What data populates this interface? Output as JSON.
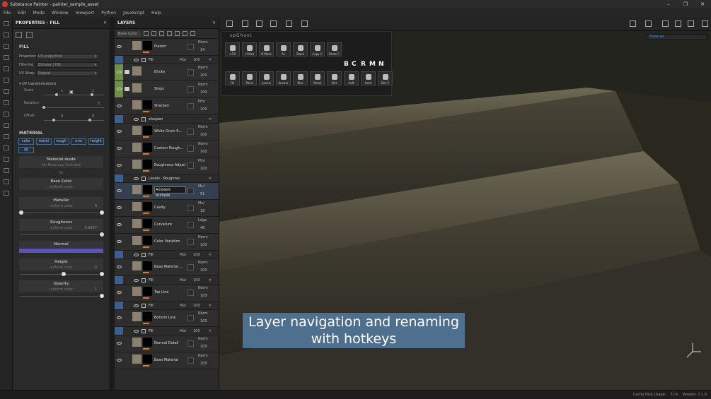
{
  "window": {
    "title": "Substance Painter - painter_sample_asset",
    "controls": [
      "–",
      "❐",
      "✕"
    ]
  },
  "menu": [
    "File",
    "Edit",
    "Mode",
    "Window",
    "Viewport",
    "Python",
    "JavaScript",
    "Help"
  ],
  "properties": {
    "panel_title": "PROPERTIES - FILL",
    "fill_header": "FILL",
    "projection_label": "Projection",
    "projection_value": "UV projection",
    "filtering_label": "Filtering",
    "filtering_value": "Bilinear | HQ",
    "uvwrap_label": "UV Wrap",
    "uvwrap_value": "Repeat",
    "uv_transformations": "UV transformations",
    "scale_label": "Scale",
    "scale_value": "1",
    "scale_value2": "1",
    "rotation_label": "Rotation",
    "rotation_value": "0",
    "offset_label": "Offset",
    "offset_value": "0",
    "offset_value2": "0",
    "material_header": "MATERIAL",
    "channels": [
      "color",
      "metal",
      "rough",
      "nrm",
      "height",
      "op"
    ],
    "material_mode": "Material mode",
    "no_resource": "No Resource Selected",
    "or": "Or",
    "base_color": "Base Color",
    "uniform": "uniform color",
    "metallic": "Metallic",
    "metallic_value": "0",
    "roughness": "Roughness",
    "roughness_value": "0.9807",
    "normal": "Normal",
    "normal_color": "#5d52b8",
    "height": "Height",
    "height_value": "0",
    "opacity": "Opacity",
    "opacity_value": "1"
  },
  "layers": {
    "panel_title": "LAYERS",
    "channel_select": "Base Color",
    "items": [
      {
        "name": "Plaster",
        "blend": "Norm",
        "opacity": "14",
        "kind": "layer"
      },
      {
        "name": "Fill",
        "blend": "Mul",
        "opacity": "100",
        "kind": "sub"
      },
      {
        "name": "Bricks",
        "blend": "Norm",
        "opacity": "100",
        "kind": "folder"
      },
      {
        "name": "Steps",
        "blend": "Norm",
        "opacity": "100",
        "kind": "folder"
      },
      {
        "name": "Sharpen",
        "blend": "Pthr",
        "opacity": "100",
        "kind": "layer"
      },
      {
        "name": "sharpen",
        "blend": "",
        "opacity": "",
        "kind": "sub"
      },
      {
        "name": "White Grain R...",
        "blend": "Norm",
        "opacity": "100",
        "kind": "layer"
      },
      {
        "name": "Custom Rough...",
        "blend": "Norm",
        "opacity": "100",
        "kind": "layer"
      },
      {
        "name": "Roughness Adjust",
        "blend": "Pthr",
        "opacity": "100",
        "kind": "layer"
      },
      {
        "name": "Levels - Roughness",
        "blend": "",
        "opacity": "",
        "kind": "sub"
      },
      {
        "name": "Ambient occlusio",
        "blend": "Mul",
        "opacity": "51",
        "kind": "editing"
      },
      {
        "name": "Cavity",
        "blend": "Mul",
        "opacity": "18",
        "kind": "layer"
      },
      {
        "name": "Curvature",
        "blend": "Ldge",
        "opacity": "48",
        "kind": "layer"
      },
      {
        "name": "Color Variation",
        "blend": "Norm",
        "opacity": "100",
        "kind": "layer"
      },
      {
        "name": "Fill",
        "blend": "Mul",
        "opacity": "100",
        "kind": "sub"
      },
      {
        "name": "Base Material ...",
        "blend": "Norm",
        "opacity": "100",
        "kind": "layer"
      },
      {
        "name": "Fill",
        "blend": "Mul",
        "opacity": "100",
        "kind": "sub"
      },
      {
        "name": "Top Line",
        "blend": "Norm",
        "opacity": "100",
        "kind": "layer"
      },
      {
        "name": "Fill",
        "blend": "Mul",
        "opacity": "100",
        "kind": "sub"
      },
      {
        "name": "Bottom Line",
        "blend": "Norm",
        "opacity": "100",
        "kind": "layer"
      },
      {
        "name": "Fill",
        "blend": "Mul",
        "opacity": "100",
        "kind": "sub"
      },
      {
        "name": "Normal Detail",
        "blend": "Norm",
        "opacity": "100",
        "kind": "layer"
      },
      {
        "name": "Base Material",
        "blend": "Norm",
        "opacity": "100",
        "kind": "layer"
      }
    ]
  },
  "viewport": {
    "material_select": "Material",
    "shelf_title": "spGhost",
    "shelf_row1": [
      "+Fill",
      "+Paint",
      "B Mask",
      "AL",
      "Stack",
      "Copy C",
      "Paste C"
    ],
    "shelf_row2": [
      "Fill",
      "Paint",
      "Levels",
      "Anchor",
      "Blur",
      "Metal",
      "Dirt",
      "Soft",
      "Hard",
      "Dirt 2"
    ],
    "shelf_letters": [
      "B",
      "C",
      "R",
      "M",
      "N"
    ],
    "caption_line1": "Layer navigation and renaming",
    "caption_line2": "with hotkeys"
  },
  "status": {
    "cache": "Cache Disk Usage:",
    "cache_value": "71%",
    "version": "Version: 7.1.0"
  },
  "colors": {
    "accent": "#e07a20",
    "selection": "#4c8fd6",
    "caption_bg": "#4f6f8f"
  }
}
